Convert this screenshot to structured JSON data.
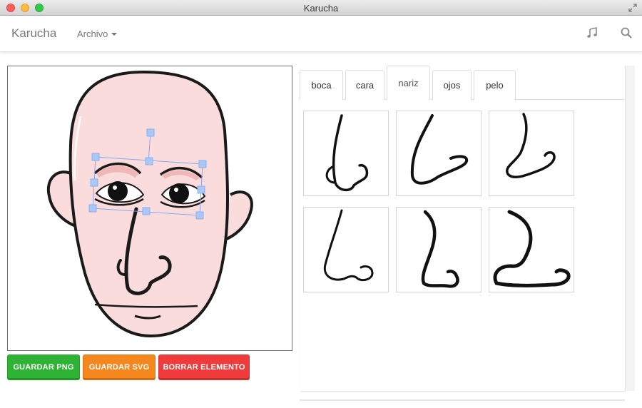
{
  "window": {
    "title": "Karucha"
  },
  "navbar": {
    "brand": "Karucha",
    "menu_label": "Archivo",
    "icons": [
      "music-note-icon",
      "search-icon"
    ]
  },
  "tabs": [
    {
      "label": "boca",
      "active": false
    },
    {
      "label": "cara",
      "active": false
    },
    {
      "label": "nariz",
      "active": true
    },
    {
      "label": "ojos",
      "active": false
    },
    {
      "label": "pelo",
      "active": false
    }
  ],
  "buttons": {
    "save_png": "GUARDAR PNG",
    "save_svg": "GUARDAR SVG",
    "delete_element": "BORRAR ELEMENTO"
  },
  "nose_options_count": 6,
  "colors": {
    "skin": "#fbdcdc",
    "selection": "#aac8f7",
    "green": "#2fb335",
    "orange": "#f5871f",
    "red": "#ef3b3b"
  }
}
